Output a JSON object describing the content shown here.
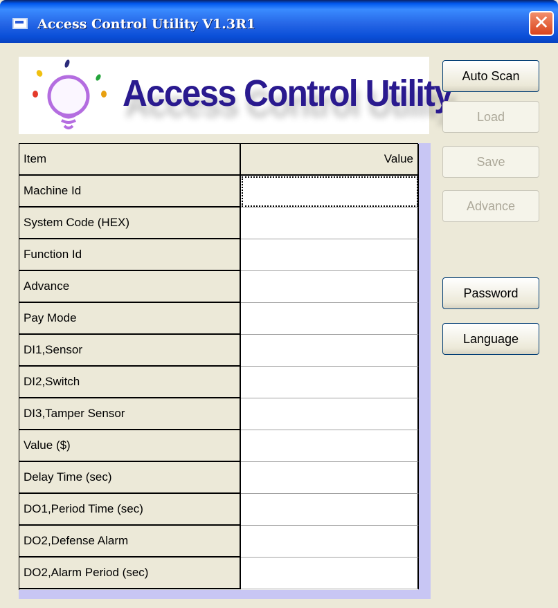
{
  "window": {
    "title": "Access Control Utility V1.3R1",
    "close_glyph": "✕"
  },
  "banner": {
    "text": "Access Control Utility",
    "icon": "lightbulb-icon"
  },
  "buttons": [
    {
      "label": "Auto Scan",
      "enabled": true
    },
    {
      "label": "Load",
      "enabled": false
    },
    {
      "label": "Save",
      "enabled": false
    },
    {
      "label": "Advance",
      "enabled": false
    },
    {
      "label": "Password",
      "enabled": true
    },
    {
      "label": "Language",
      "enabled": true
    }
  ],
  "grid": {
    "columns": [
      "Item",
      "Value"
    ],
    "rows": [
      {
        "item": "Machine Id",
        "value": ""
      },
      {
        "item": "System Code (HEX)",
        "value": ""
      },
      {
        "item": "Function Id",
        "value": ""
      },
      {
        "item": "Advance",
        "value": ""
      },
      {
        "item": "Pay Mode",
        "value": ""
      },
      {
        "item": "DI1,Sensor",
        "value": ""
      },
      {
        "item": "DI2,Switch",
        "value": ""
      },
      {
        "item": "DI3,Tamper Sensor",
        "value": ""
      },
      {
        "item": "Value ($)",
        "value": ""
      },
      {
        "item": "Delay Time (sec)",
        "value": ""
      },
      {
        "item": "DO1,Period Time (sec)",
        "value": ""
      },
      {
        "item": "DO2,Defense Alarm",
        "value": ""
      },
      {
        "item": "DO2,Alarm Period (sec)",
        "value": ""
      }
    ]
  },
  "colors": {
    "titlebar": "#0058ee",
    "banner_text": "#2a1a8f",
    "grid_frame": "#c8c6f4"
  }
}
